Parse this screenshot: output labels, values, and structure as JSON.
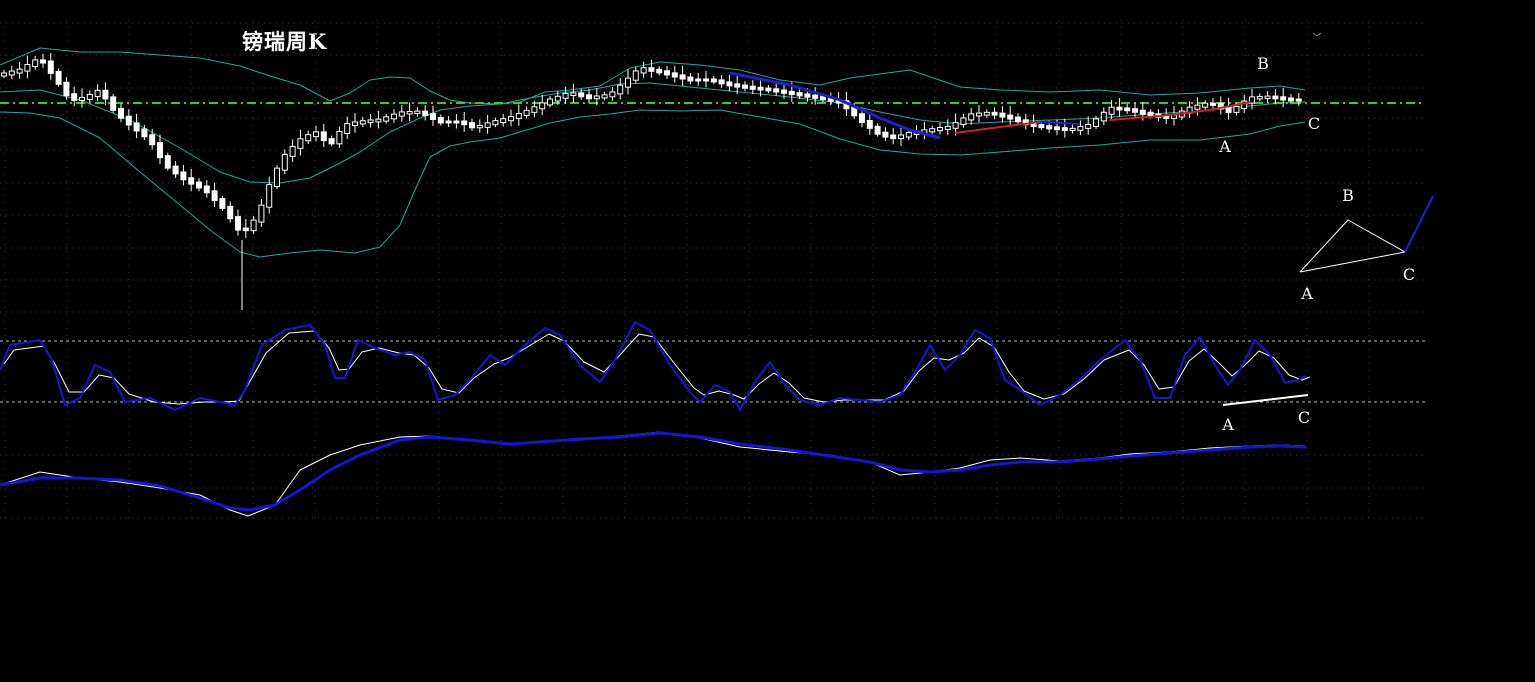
{
  "chart_data": {
    "type": "line",
    "title": "镑瑞周K",
    "grid": true,
    "colors": {
      "background": "#000000",
      "candle": "#ffffff",
      "bollinger": "#2aa3a3",
      "reference_line": "#33cc33",
      "indicator_fast": "#1515d6",
      "indicator_slow": "#ffffff",
      "trend_down": "#1f1fcc",
      "trend_up": "#cc2222",
      "grid": "#3a3a3a"
    },
    "panels": [
      {
        "name": "price",
        "type": "candlestick_with_bollinger",
        "annotations": [
          "A",
          "B",
          "C"
        ],
        "pattern_annotations": [
          "B",
          "A",
          "C"
        ]
      },
      {
        "name": "oscillator",
        "type": "line",
        "annotations": [
          "A",
          "C"
        ]
      },
      {
        "name": "trend",
        "type": "line"
      }
    ]
  }
}
